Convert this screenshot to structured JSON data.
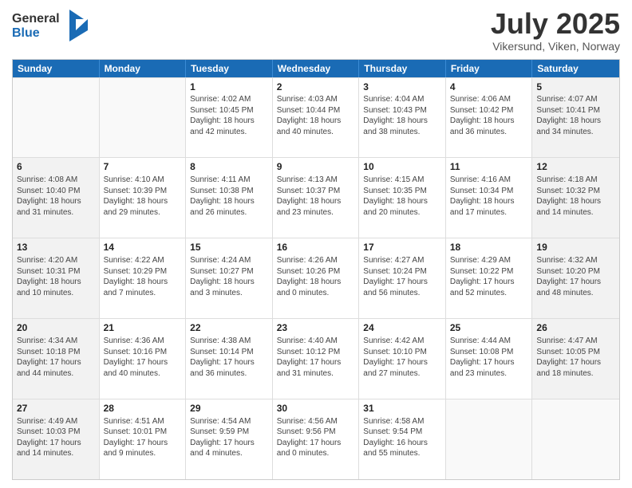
{
  "header": {
    "logo_text_general": "General",
    "logo_text_blue": "Blue",
    "month": "July 2025",
    "location": "Vikersund, Viken, Norway"
  },
  "days_of_week": [
    "Sunday",
    "Monday",
    "Tuesday",
    "Wednesday",
    "Thursday",
    "Friday",
    "Saturday"
  ],
  "weeks": [
    [
      {
        "day": "",
        "info": "",
        "empty": true
      },
      {
        "day": "",
        "info": "",
        "empty": true
      },
      {
        "day": "1",
        "info": "Sunrise: 4:02 AM\nSunset: 10:45 PM\nDaylight: 18 hours\nand 42 minutes."
      },
      {
        "day": "2",
        "info": "Sunrise: 4:03 AM\nSunset: 10:44 PM\nDaylight: 18 hours\nand 40 minutes."
      },
      {
        "day": "3",
        "info": "Sunrise: 4:04 AM\nSunset: 10:43 PM\nDaylight: 18 hours\nand 38 minutes."
      },
      {
        "day": "4",
        "info": "Sunrise: 4:06 AM\nSunset: 10:42 PM\nDaylight: 18 hours\nand 36 minutes."
      },
      {
        "day": "5",
        "info": "Sunrise: 4:07 AM\nSunset: 10:41 PM\nDaylight: 18 hours\nand 34 minutes."
      }
    ],
    [
      {
        "day": "6",
        "info": "Sunrise: 4:08 AM\nSunset: 10:40 PM\nDaylight: 18 hours\nand 31 minutes."
      },
      {
        "day": "7",
        "info": "Sunrise: 4:10 AM\nSunset: 10:39 PM\nDaylight: 18 hours\nand 29 minutes."
      },
      {
        "day": "8",
        "info": "Sunrise: 4:11 AM\nSunset: 10:38 PM\nDaylight: 18 hours\nand 26 minutes."
      },
      {
        "day": "9",
        "info": "Sunrise: 4:13 AM\nSunset: 10:37 PM\nDaylight: 18 hours\nand 23 minutes."
      },
      {
        "day": "10",
        "info": "Sunrise: 4:15 AM\nSunset: 10:35 PM\nDaylight: 18 hours\nand 20 minutes."
      },
      {
        "day": "11",
        "info": "Sunrise: 4:16 AM\nSunset: 10:34 PM\nDaylight: 18 hours\nand 17 minutes."
      },
      {
        "day": "12",
        "info": "Sunrise: 4:18 AM\nSunset: 10:32 PM\nDaylight: 18 hours\nand 14 minutes."
      }
    ],
    [
      {
        "day": "13",
        "info": "Sunrise: 4:20 AM\nSunset: 10:31 PM\nDaylight: 18 hours\nand 10 minutes."
      },
      {
        "day": "14",
        "info": "Sunrise: 4:22 AM\nSunset: 10:29 PM\nDaylight: 18 hours\nand 7 minutes."
      },
      {
        "day": "15",
        "info": "Sunrise: 4:24 AM\nSunset: 10:27 PM\nDaylight: 18 hours\nand 3 minutes."
      },
      {
        "day": "16",
        "info": "Sunrise: 4:26 AM\nSunset: 10:26 PM\nDaylight: 18 hours\nand 0 minutes."
      },
      {
        "day": "17",
        "info": "Sunrise: 4:27 AM\nSunset: 10:24 PM\nDaylight: 17 hours\nand 56 minutes."
      },
      {
        "day": "18",
        "info": "Sunrise: 4:29 AM\nSunset: 10:22 PM\nDaylight: 17 hours\nand 52 minutes."
      },
      {
        "day": "19",
        "info": "Sunrise: 4:32 AM\nSunset: 10:20 PM\nDaylight: 17 hours\nand 48 minutes."
      }
    ],
    [
      {
        "day": "20",
        "info": "Sunrise: 4:34 AM\nSunset: 10:18 PM\nDaylight: 17 hours\nand 44 minutes."
      },
      {
        "day": "21",
        "info": "Sunrise: 4:36 AM\nSunset: 10:16 PM\nDaylight: 17 hours\nand 40 minutes."
      },
      {
        "day": "22",
        "info": "Sunrise: 4:38 AM\nSunset: 10:14 PM\nDaylight: 17 hours\nand 36 minutes."
      },
      {
        "day": "23",
        "info": "Sunrise: 4:40 AM\nSunset: 10:12 PM\nDaylight: 17 hours\nand 31 minutes."
      },
      {
        "day": "24",
        "info": "Sunrise: 4:42 AM\nSunset: 10:10 PM\nDaylight: 17 hours\nand 27 minutes."
      },
      {
        "day": "25",
        "info": "Sunrise: 4:44 AM\nSunset: 10:08 PM\nDaylight: 17 hours\nand 23 minutes."
      },
      {
        "day": "26",
        "info": "Sunrise: 4:47 AM\nSunset: 10:05 PM\nDaylight: 17 hours\nand 18 minutes."
      }
    ],
    [
      {
        "day": "27",
        "info": "Sunrise: 4:49 AM\nSunset: 10:03 PM\nDaylight: 17 hours\nand 14 minutes."
      },
      {
        "day": "28",
        "info": "Sunrise: 4:51 AM\nSunset: 10:01 PM\nDaylight: 17 hours\nand 9 minutes."
      },
      {
        "day": "29",
        "info": "Sunrise: 4:54 AM\nSunset: 9:59 PM\nDaylight: 17 hours\nand 4 minutes."
      },
      {
        "day": "30",
        "info": "Sunrise: 4:56 AM\nSunset: 9:56 PM\nDaylight: 17 hours\nand 0 minutes."
      },
      {
        "day": "31",
        "info": "Sunrise: 4:58 AM\nSunset: 9:54 PM\nDaylight: 16 hours\nand 55 minutes."
      },
      {
        "day": "",
        "info": "",
        "empty": true
      },
      {
        "day": "",
        "info": "",
        "empty": true
      }
    ]
  ]
}
